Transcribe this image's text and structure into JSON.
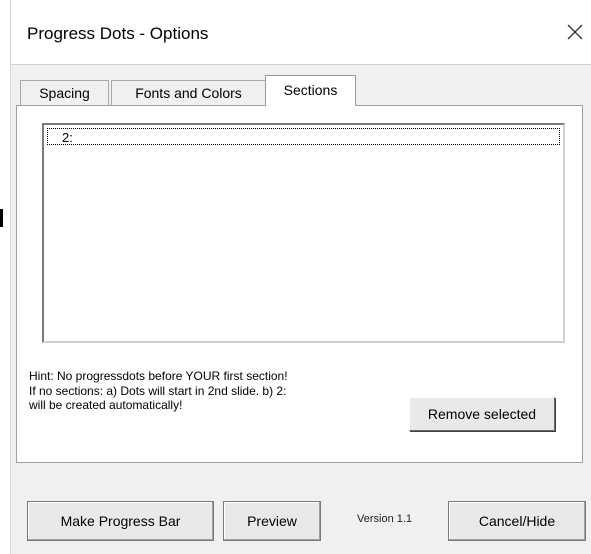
{
  "window": {
    "title": "Progress Dots - Options"
  },
  "tabs": [
    {
      "label": "Spacing",
      "active": false
    },
    {
      "label": "Fonts and Colors",
      "active": false
    },
    {
      "label": "Sections",
      "active": true
    }
  ],
  "sections_list": {
    "items": [
      "2:"
    ]
  },
  "hint": {
    "lines": [
      "Hint: No progressdots before YOUR first section!",
      "If no sections: a) Dots will start in 2nd slide. b) 2:",
      "will be created automatically!"
    ]
  },
  "buttons": {
    "remove_selected": "Remove selected",
    "make_progress_bar": "Make Progress Bar",
    "preview": "Preview",
    "cancel_hide": "Cancel/Hide"
  },
  "footer": {
    "version": "Version 1.1"
  },
  "icons": {
    "close": "close-icon"
  }
}
